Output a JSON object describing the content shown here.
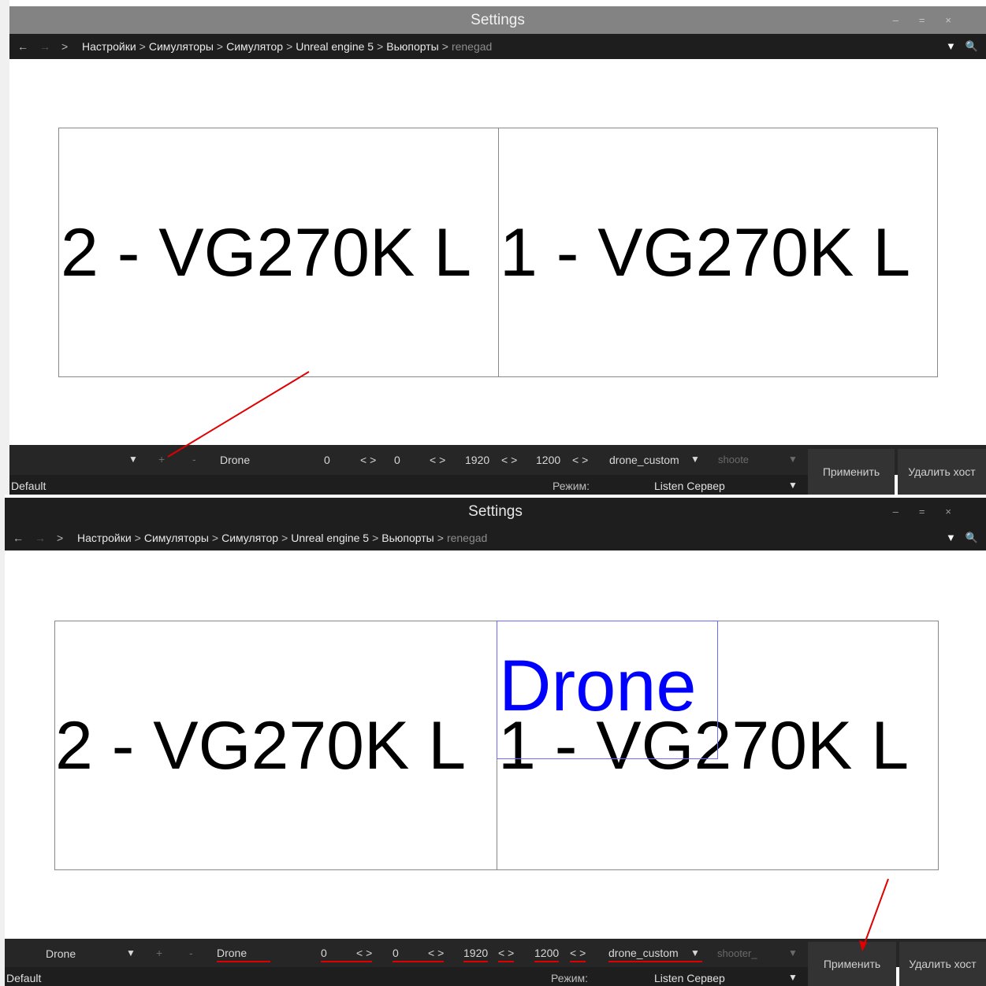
{
  "top": {
    "window_title": "Settings",
    "nav": {
      "back": "←",
      "forward": "→",
      "crumb_arrow": ">"
    },
    "breadcrumbs": [
      "Настройки",
      "Симуляторы",
      "Симулятор",
      "Unreal engine 5",
      "Вьюпорты",
      "renegad"
    ],
    "monitors": [
      "2 - VG270K L",
      "1 - VG270K L"
    ],
    "toolbar": {
      "profile_select": "",
      "add": "+",
      "remove": "-",
      "name_value": "Drone",
      "x_value": "0",
      "y_value": "0",
      "width_value": "1920",
      "height_value": "1200",
      "arrows": "< >",
      "preset_select": "drone_custom",
      "type_select": "shoote",
      "apply": "Применить",
      "delete_host": "Удалить хост"
    },
    "status": {
      "profile": "Default",
      "mode_label": "Режим:",
      "mode_value": "Listen Сервер"
    }
  },
  "bottom": {
    "window_title": "Settings",
    "nav": {
      "back": "←",
      "forward": "→",
      "crumb_arrow": ">"
    },
    "breadcrumbs": [
      "Настройки",
      "Симуляторы",
      "Симулятор",
      "Unreal engine 5",
      "Вьюпорты",
      "renegad"
    ],
    "monitors": [
      "2 - VG270K L",
      "1 - VG270K L"
    ],
    "viewport_label": "Drone",
    "toolbar": {
      "profile_select": "Drone",
      "add": "+",
      "remove": "-",
      "name_value": "Drone",
      "x_value": "0",
      "y_value": "0",
      "width_value": "1920",
      "height_value": "1200",
      "arrows": "< >",
      "preset_select": "drone_custom",
      "type_select": "shooter_",
      "apply": "Применить",
      "delete_host": "Удалить хост"
    },
    "status": {
      "profile": "Default",
      "mode_label": "Режим:",
      "mode_value": "Listen Сервер"
    }
  },
  "icons": {
    "dropdown": "▼",
    "search": "🔍",
    "minimize": "–",
    "maximize": "=",
    "close": "×"
  },
  "colors": {
    "annotation": "#e00000",
    "viewport_label": "#0000ff",
    "bar": "#1e1e1e"
  }
}
